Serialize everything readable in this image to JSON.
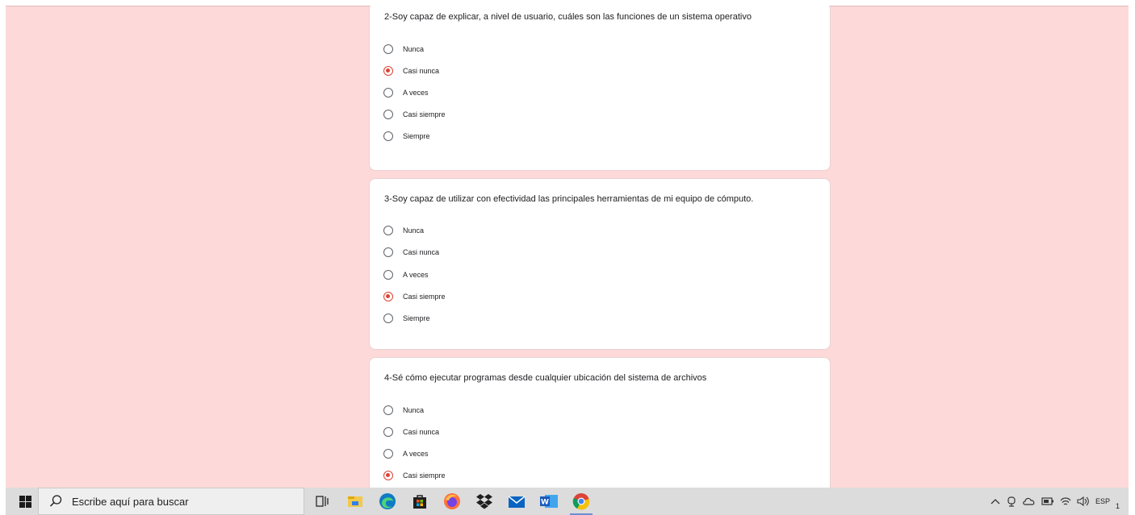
{
  "questions": [
    {
      "title": "2-Soy capaz de explicar, a nivel de usuario, cuáles son las funciones de un sistema operativo",
      "options": [
        "Nunca",
        "Casi nunca",
        "A veces",
        "Casi siempre",
        "Siempre"
      ],
      "selected": "Casi nunca"
    },
    {
      "title": "3-Soy capaz de utilizar con efectividad las principales herramientas de mi equipo de cómputo.",
      "options": [
        "Nunca",
        "Casi nunca",
        "A veces",
        "Casi siempre",
        "Siempre"
      ],
      "selected": "Casi siempre"
    },
    {
      "title": "4-Sé cómo ejecutar programas desde cualquier ubicación del sistema de archivos",
      "options": [
        "Nunca",
        "Casi nunca",
        "A veces",
        "Casi siempre"
      ],
      "selected": "Casi siempre"
    }
  ],
  "colors": {
    "page_background": "#fdd9d9",
    "accent": "#db4437",
    "card": "#ffffff",
    "taskbar": "#dcdcdc"
  },
  "taskbar": {
    "search_placeholder": "Escribe aquí para buscar",
    "apps": [
      "task-view-icon",
      "file-explorer-icon",
      "edge-icon",
      "store-icon",
      "firefox-icon",
      "dropbox-icon",
      "mail-icon",
      "word-icon",
      "chrome-icon"
    ],
    "tray": {
      "language": "ESP",
      "clock_fragment": "1"
    }
  }
}
